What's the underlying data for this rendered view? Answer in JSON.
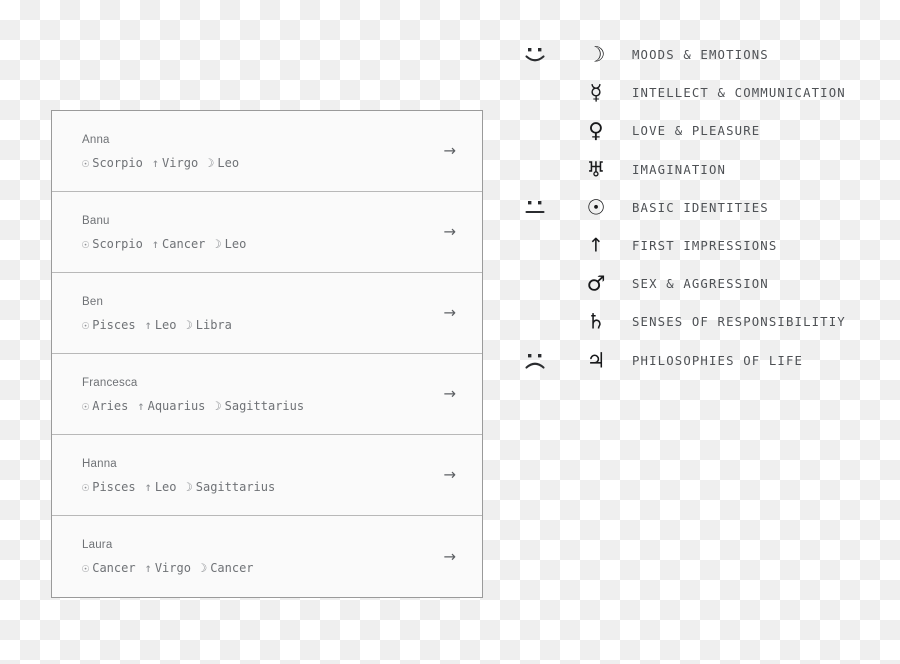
{
  "profiles": {
    "sun_glyph": "☉",
    "ascendant_glyph": "↑",
    "moon_glyph": "☽",
    "arrow_glyph": "→",
    "rows": [
      {
        "name": "Anna",
        "sun": "Scorpio",
        "ascendant": "Virgo",
        "moon": "Leo"
      },
      {
        "name": "Banu",
        "sun": "Scorpio",
        "ascendant": "Cancer",
        "moon": "Leo"
      },
      {
        "name": "Ben",
        "sun": "Pisces",
        "ascendant": "Leo",
        "moon": "Libra"
      },
      {
        "name": "Francesca",
        "sun": "Aries",
        "ascendant": "Aquarius",
        "moon": "Sagittarius"
      },
      {
        "name": "Hanna",
        "sun": "Pisces",
        "ascendant": "Leo",
        "moon": "Sagittarius"
      },
      {
        "name": "Laura",
        "sun": "Cancer",
        "ascendant": "Virgo",
        "moon": "Cancer"
      }
    ]
  },
  "legend": {
    "rows": [
      {
        "face": "happy",
        "symbol": "☽",
        "symbol_name": "moon-symbol",
        "label": "MOODS & EMOTIONS"
      },
      {
        "face": "none",
        "symbol": "☿",
        "symbol_name": "mercury-symbol",
        "label": "INTELLECT & COMMUNICATION"
      },
      {
        "face": "none",
        "symbol": "♀",
        "symbol_name": "venus-symbol",
        "label": "LOVE & PLEASURE"
      },
      {
        "face": "none",
        "symbol": "♅",
        "symbol_name": "uranus-symbol",
        "label": "IMAGINATION"
      },
      {
        "face": "neutral",
        "symbol": "☉",
        "symbol_name": "sun-symbol",
        "label": "BASIC IDENTITIES"
      },
      {
        "face": "none",
        "symbol": "↑",
        "symbol_name": "ascendant-symbol",
        "label": "FIRST IMPRESSIONS"
      },
      {
        "face": "none",
        "symbol": "♂",
        "symbol_name": "mars-symbol",
        "label": "SEX & AGGRESSION"
      },
      {
        "face": "none",
        "symbol": "♄",
        "symbol_name": "saturn-symbol",
        "label": "SENSES OF RESPONSIBILITIY"
      },
      {
        "face": "sad",
        "symbol": "♃",
        "symbol_name": "jupiter-symbol",
        "label": "PHILOSOPHIES OF LIFE"
      }
    ]
  },
  "colors": {
    "card_border": "#9a9a9a",
    "row_divider": "#b8b8b8",
    "card_background": "#fafafa",
    "text_muted": "#6f7276",
    "legend_text": "#4e5155",
    "symbol_dark": "#17181a",
    "checker_light": "#ffffff",
    "checker_dark": "#efefef"
  }
}
